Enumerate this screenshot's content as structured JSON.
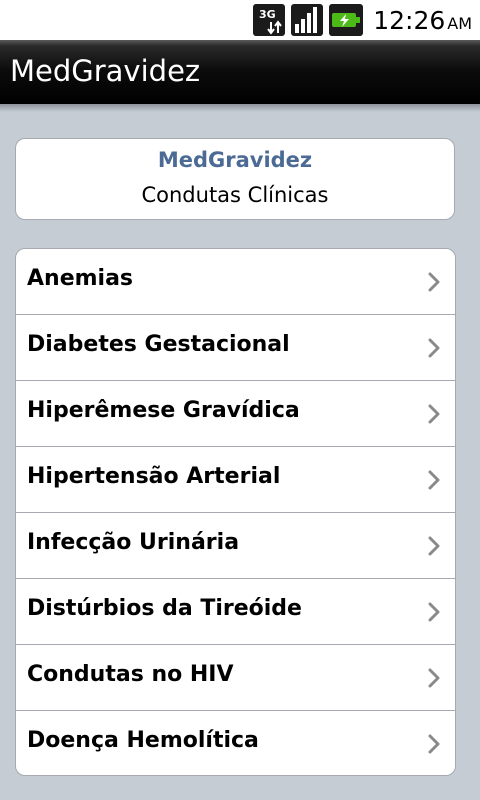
{
  "status_bar": {
    "network": "3G",
    "time": "12:26",
    "ampm": "AM",
    "icons": [
      "network-3g-icon",
      "signal-strength-icon",
      "battery-charging-icon"
    ]
  },
  "title_bar": {
    "title": "MedGravidez"
  },
  "header": {
    "title": "MedGravidez",
    "subtitle": "Condutas Clínicas"
  },
  "list": {
    "items": [
      {
        "label": "Anemias"
      },
      {
        "label": "Diabetes Gestacional"
      },
      {
        "label": "Hiperêmese Gravídica"
      },
      {
        "label": "Hipertensão Arterial"
      },
      {
        "label": "Infecção Urinária"
      },
      {
        "label": "Distúrbios da Tireóide"
      },
      {
        "label": "Condutas no HIV"
      },
      {
        "label": "Doença Hemolítica"
      }
    ],
    "item_icon": "chevron-right-icon"
  },
  "colors": {
    "background": "#c5ccd4",
    "header_title": "#4c6b94",
    "title_bar": "#000000",
    "border": "#a6aab0"
  }
}
